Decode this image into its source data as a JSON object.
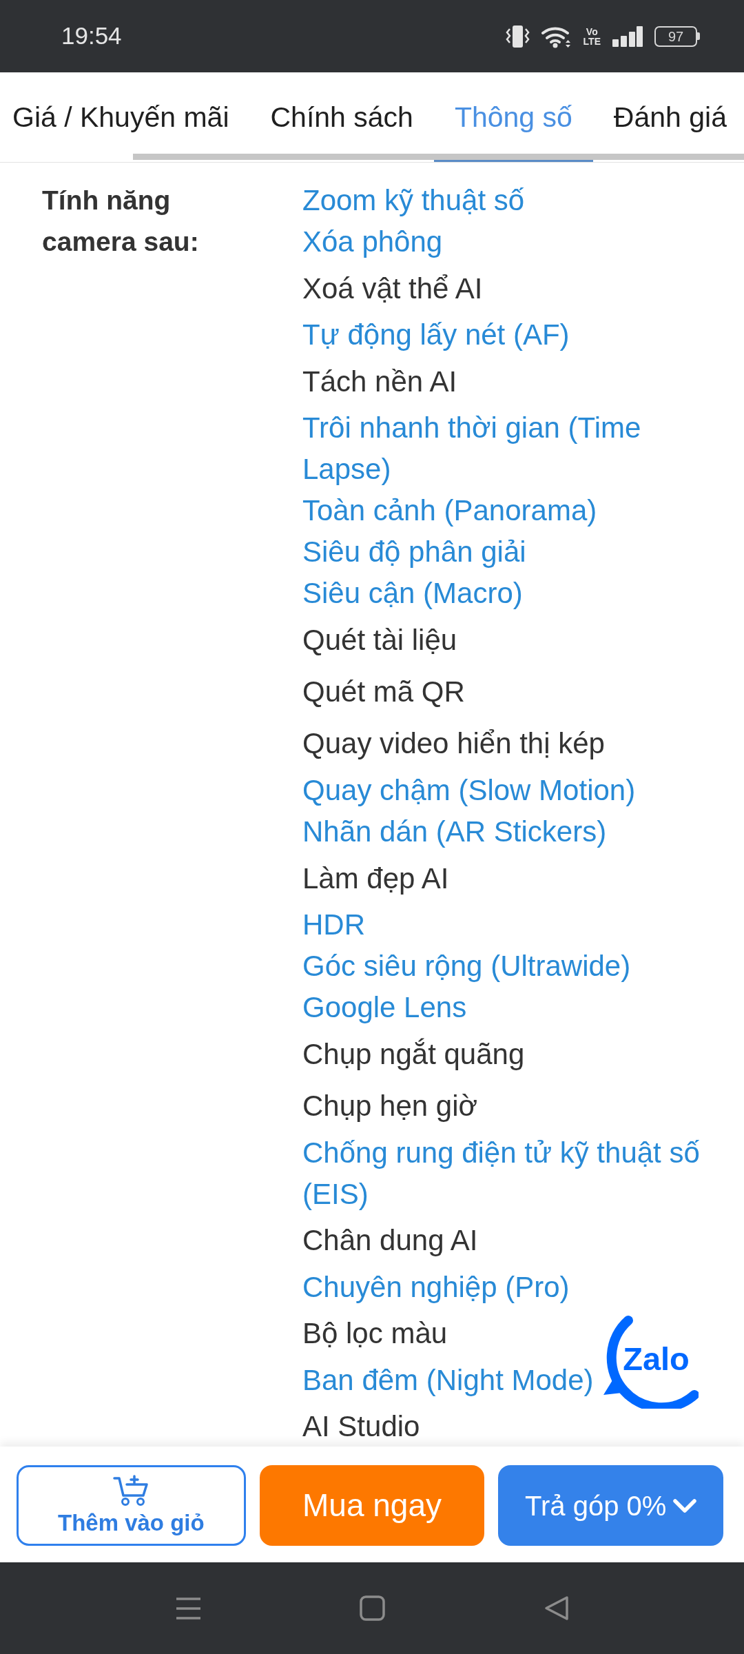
{
  "status_bar": {
    "time": "19:54",
    "network_badge": [
      "Vo",
      "LTE"
    ],
    "battery": "97"
  },
  "tabs": [
    {
      "label": "Giá / Khuyến mãi",
      "selected": false
    },
    {
      "label": "Chính sách",
      "selected": false
    },
    {
      "label": "Thông số",
      "selected": true
    },
    {
      "label": "Đánh giá",
      "selected": false
    }
  ],
  "spec": {
    "label": "Tính năng camera sau:",
    "values": [
      {
        "text": "Zoom kỹ thuật số",
        "kind": "link"
      },
      {
        "text": "Xóa phông",
        "kind": "link"
      },
      {
        "text": "Xoá vật thể AI",
        "kind": "text"
      },
      {
        "text": "Tự động lấy nét (AF)",
        "kind": "link"
      },
      {
        "text": "Tách nền AI",
        "kind": "text"
      },
      {
        "text": "Trôi nhanh thời gian (Time Lapse)",
        "kind": "link"
      },
      {
        "text": "Toàn cảnh (Panorama)",
        "kind": "link"
      },
      {
        "text": "Siêu độ phân giải",
        "kind": "link"
      },
      {
        "text": "Siêu cận (Macro)",
        "kind": "link"
      },
      {
        "text": "Quét tài liệu",
        "kind": "text"
      },
      {
        "text": "Quét mã QR",
        "kind": "text"
      },
      {
        "text": "Quay video hiển thị kép",
        "kind": "text"
      },
      {
        "text": "Quay chậm (Slow Motion)",
        "kind": "link"
      },
      {
        "text": "Nhãn dán (AR Stickers)",
        "kind": "link"
      },
      {
        "text": "Làm đẹp AI",
        "kind": "text"
      },
      {
        "text": "HDR",
        "kind": "link"
      },
      {
        "text": "Góc siêu rộng (Ultrawide)",
        "kind": "link"
      },
      {
        "text": "Google Lens",
        "kind": "link"
      },
      {
        "text": "Chụp ngắt quãng",
        "kind": "text"
      },
      {
        "text": "Chụp hẹn giờ",
        "kind": "text"
      },
      {
        "text": "Chống rung điện tử kỹ thuật số (EIS)",
        "kind": "link"
      },
      {
        "text": "Chân dung AI",
        "kind": "text"
      },
      {
        "text": "Chuyên nghiệp (Pro)",
        "kind": "link"
      },
      {
        "text": "Bộ lọc màu",
        "kind": "text"
      },
      {
        "text": "Ban đêm (Night Mode)",
        "kind": "link"
      },
      {
        "text": "AI Studio",
        "kind": "text"
      }
    ]
  },
  "zalo_button": {
    "label": "Zalo"
  },
  "action_bar": {
    "buttons": [
      {
        "label": "Thêm vào giỏ",
        "kind": "cart"
      },
      {
        "label": "Mua ngay",
        "kind": "buy"
      },
      {
        "label": "Trả góp 0%",
        "kind": "installment"
      }
    ]
  }
}
